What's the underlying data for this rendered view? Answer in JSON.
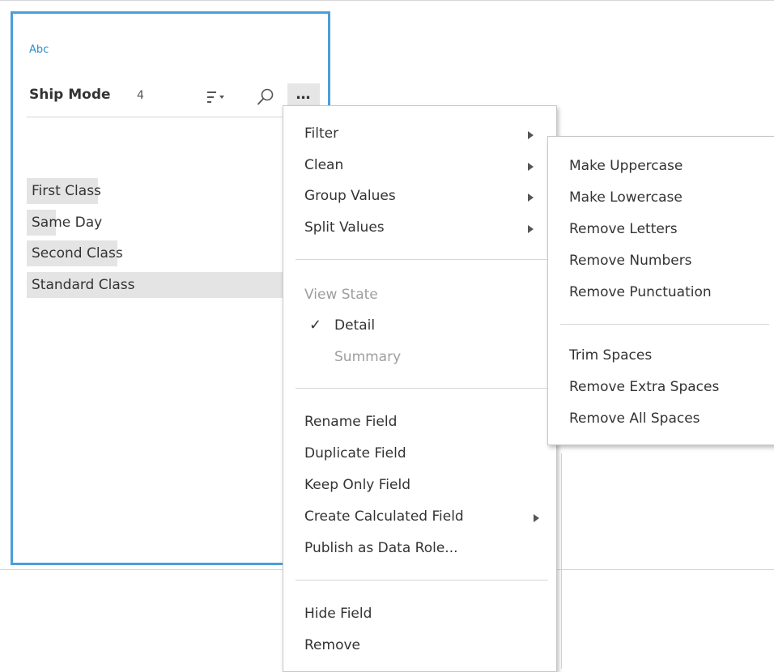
{
  "field_card": {
    "type_label": "Abc",
    "name": "Ship Mode",
    "count": "4",
    "sort_icon": "sort-dropdown-icon",
    "search_icon": "search-icon",
    "more_icon": "more-icon",
    "more_label": "…",
    "values": [
      {
        "label": "First Class",
        "fill": 0.25
      },
      {
        "label": "Same Day",
        "fill": 0.1
      },
      {
        "label": "Second Class",
        "fill": 0.32
      },
      {
        "label": "Standard Class",
        "fill": 1.0
      }
    ]
  },
  "menu": {
    "filter": "Filter",
    "clean": "Clean",
    "group_values": "Group Values",
    "split_values": "Split Values",
    "view_state": "View State",
    "detail": "Detail",
    "detail_check": "✓",
    "summary": "Summary",
    "rename_field": "Rename Field",
    "duplicate_field": "Duplicate Field",
    "keep_only_field": "Keep Only Field",
    "create_calculated_field": "Create Calculated Field",
    "publish_as_data_role": "Publish as Data Role...",
    "hide_field": "Hide Field",
    "remove": "Remove"
  },
  "clean_submenu": {
    "make_uppercase": "Make Uppercase",
    "make_lowercase": "Make Lowercase",
    "remove_letters": "Remove Letters",
    "remove_numbers": "Remove Numbers",
    "remove_punctuation": "Remove Punctuation",
    "trim_spaces": "Trim Spaces",
    "remove_extra_spaces": "Remove Extra Spaces",
    "remove_all_spaces": "Remove All Spaces"
  }
}
